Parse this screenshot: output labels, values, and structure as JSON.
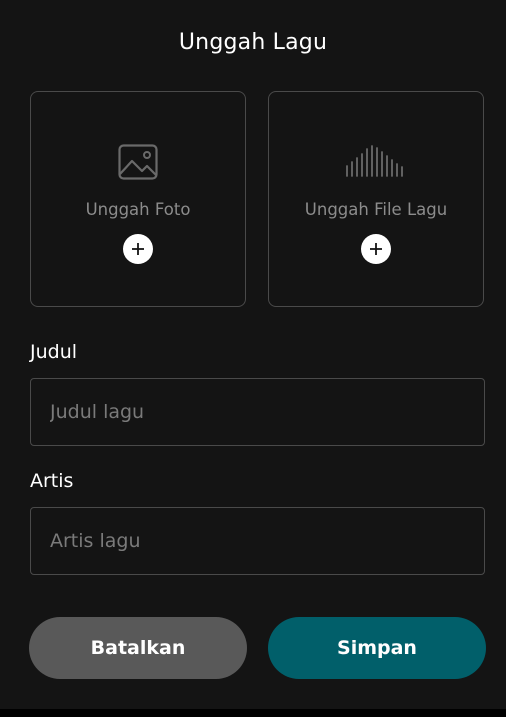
{
  "header": {
    "title": "Unggah Lagu"
  },
  "uploads": {
    "photo": {
      "label": "Unggah Foto",
      "icon": "image-icon",
      "add_icon": "plus-icon"
    },
    "song": {
      "label": "Unggah File Lagu",
      "icon": "audio-waveform-icon",
      "add_icon": "plus-icon"
    }
  },
  "form": {
    "title_field": {
      "label": "Judul",
      "placeholder": "Judul lagu",
      "value": ""
    },
    "artist_field": {
      "label": "Artis",
      "placeholder": "Artis lagu",
      "value": ""
    }
  },
  "actions": {
    "cancel_label": "Batalkan",
    "save_label": "Simpan"
  },
  "colors": {
    "background": "#141414",
    "border": "#4a4a4a",
    "cancel_button": "#595959",
    "save_button": "#015f6a",
    "muted_text": "#8c8c8c"
  }
}
